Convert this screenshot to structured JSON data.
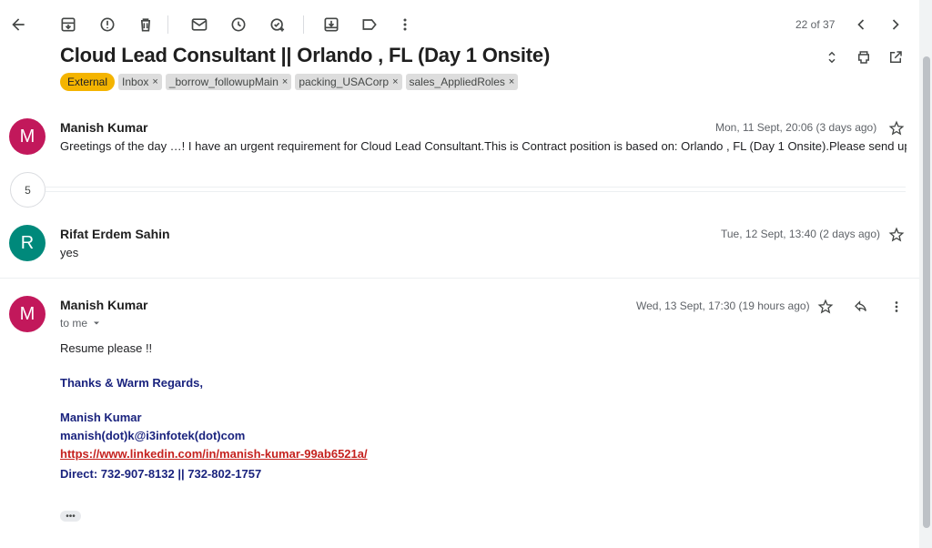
{
  "toolbar": {
    "pager": "22 of 37",
    "icons": [
      "back-arrow-icon",
      "archive-icon",
      "report-spam-icon",
      "delete-icon",
      "mark-unread-icon",
      "snooze-icon",
      "add-task-icon",
      "move-to-icon",
      "label-icon",
      "more-vert-icon",
      "newer-chevron-icon",
      "older-chevron-icon"
    ]
  },
  "subject": "Cloud Lead Consultant || Orlando , FL (Day 1 Onsite)",
  "labels": {
    "external": "External",
    "items": [
      "Inbox",
      "_borrow_followupMain",
      "packing_USACorp",
      "sales_AppliedRoles"
    ],
    "remove": "×"
  },
  "messages": [
    {
      "avatar_letter": "M",
      "avatar_color": "#c2185b",
      "sender": "Manish Kumar",
      "date": "Mon, 11 Sept, 20:06 (3 days ago)",
      "snippet": "Greetings of the day …! I have an urgent requirement for Cloud Lead Consultant.This is Contract position is based on: Orlando , FL (Day 1 Onsite).Please send up"
    },
    {
      "avatar_letter": "R",
      "avatar_color": "#00897b",
      "sender": "Rifat Erdem Sahin",
      "date": "Tue, 12 Sept, 13:40 (2 days ago)",
      "snippet": "yes"
    },
    {
      "avatar_letter": "M",
      "avatar_color": "#c2185b",
      "sender": "Manish Kumar",
      "date": "Wed, 13 Sept, 17:30 (19 hours ago)",
      "to": "to me",
      "body": "Resume please !!",
      "signature": {
        "greeting": "Thanks & Warm Regards,",
        "name": "Manish Kumar",
        "email": "manish(dot)k@i3infotek(dot)com",
        "linkedin": "https://www.linkedin.com/in/manish-kumar-99ab6521a/",
        "phone": "Direct: 732-907-8132 || 732-802-1757"
      },
      "trimmed": "•••"
    }
  ],
  "collapsed_count": "5",
  "colors": {
    "external_label": "#f4b400",
    "signature_text": "#1a237e",
    "link": "#c5221f"
  }
}
